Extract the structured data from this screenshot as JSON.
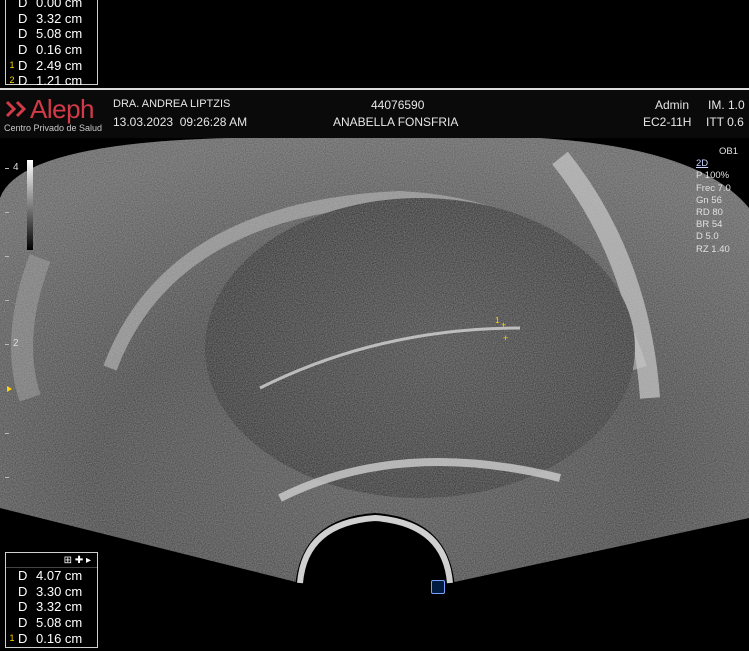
{
  "measurements_top": [
    {
      "index": "",
      "label": "D",
      "value": "0.00 cm"
    },
    {
      "index": "",
      "label": "D",
      "value": "3.32 cm"
    },
    {
      "index": "",
      "label": "D",
      "value": "5.08 cm"
    },
    {
      "index": "",
      "label": "D",
      "value": "0.16 cm"
    },
    {
      "index": "1",
      "label": "D",
      "value": "2.49 cm"
    },
    {
      "index": "2",
      "label": "D",
      "value": "1.21 cm"
    }
  ],
  "measurements_bottom": {
    "head_icons": "⊞ ✚ ▸",
    "rows": [
      {
        "index": "",
        "label": "D",
        "value": "4.07 cm"
      },
      {
        "index": "",
        "label": "D",
        "value": "3.30 cm"
      },
      {
        "index": "",
        "label": "D",
        "value": "3.32 cm"
      },
      {
        "index": "",
        "label": "D",
        "value": "5.08 cm"
      },
      {
        "index": "1",
        "label": "D",
        "value": "0.16 cm"
      }
    ]
  },
  "header": {
    "logo": "Aleph",
    "logo_sub": "Centro Privado de Salud",
    "doctor": "DRA. ANDREA LIPTZIS",
    "datetime": "13.03.2023  09:26:28 AM",
    "patient_id": "44076590",
    "patient_name": "ANABELLA FONSFRIA",
    "user": "Admin",
    "probe": "EC2-11H",
    "im": "IM. 1.0",
    "itt": "ITT 0.6"
  },
  "params": {
    "preset": "OB1",
    "mode": "2D",
    "lines": [
      "P 100%",
      "Frec 7.0",
      "Gn 56",
      "RD 80",
      "BR 54",
      "D 5.0",
      "RZ 1.40"
    ]
  },
  "depth_scale": {
    "label_4": "4",
    "label_2": "2"
  },
  "calipers": {
    "c1": "1",
    "c2": "+",
    "c3": "+"
  },
  "colors": {
    "logo": "#d23a47",
    "caliper": "#ffd400"
  }
}
